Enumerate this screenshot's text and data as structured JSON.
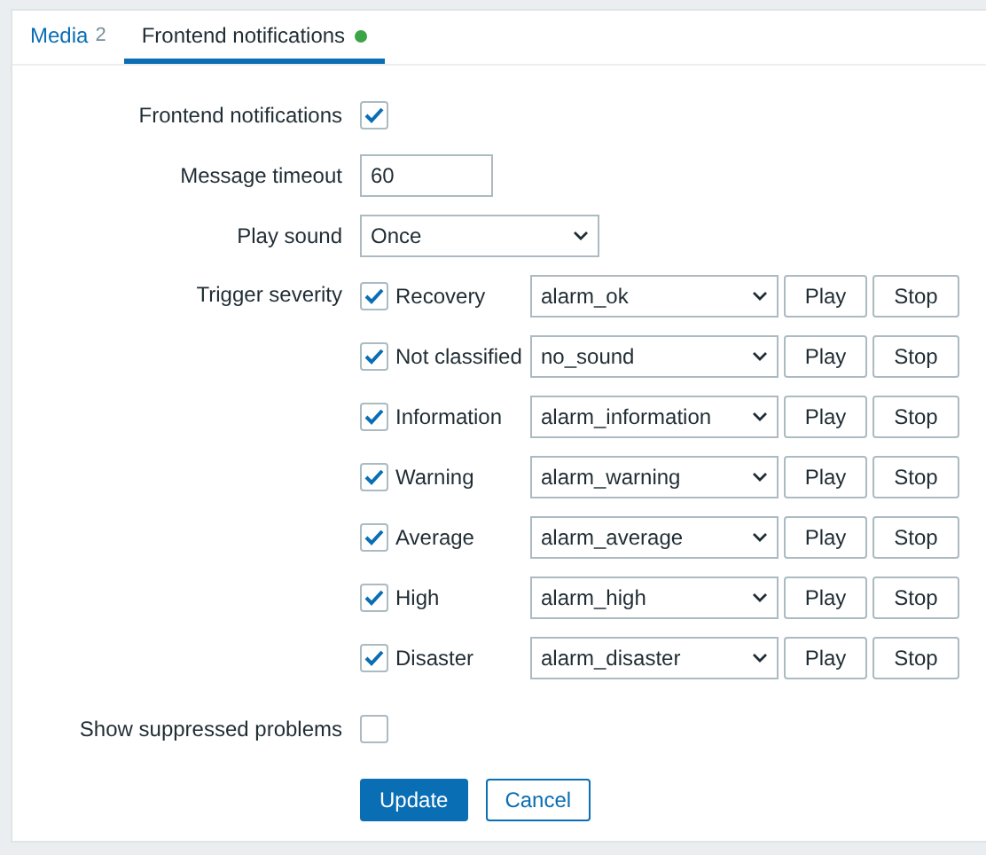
{
  "tabs": [
    {
      "label": "Media",
      "count": "2",
      "status_dot": false,
      "selected": false
    },
    {
      "label": "Frontend notifications",
      "status_dot": true,
      "selected": true
    }
  ],
  "form": {
    "frontend_notifications": {
      "label": "Frontend notifications",
      "checked": true
    },
    "message_timeout": {
      "label": "Message timeout",
      "value": "60"
    },
    "play_sound": {
      "label": "Play sound",
      "value": "Once"
    },
    "trigger_severity": {
      "label": "Trigger severity",
      "rows": [
        {
          "name": "Recovery",
          "checked": true,
          "sound": "alarm_ok",
          "play": "Play",
          "stop": "Stop"
        },
        {
          "name": "Not classified",
          "checked": true,
          "sound": "no_sound",
          "play": "Play",
          "stop": "Stop"
        },
        {
          "name": "Information",
          "checked": true,
          "sound": "alarm_information",
          "play": "Play",
          "stop": "Stop"
        },
        {
          "name": "Warning",
          "checked": true,
          "sound": "alarm_warning",
          "play": "Play",
          "stop": "Stop"
        },
        {
          "name": "Average",
          "checked": true,
          "sound": "alarm_average",
          "play": "Play",
          "stop": "Stop"
        },
        {
          "name": "High",
          "checked": true,
          "sound": "alarm_high",
          "play": "Play",
          "stop": "Stop"
        },
        {
          "name": "Disaster",
          "checked": true,
          "sound": "alarm_disaster",
          "play": "Play",
          "stop": "Stop"
        }
      ]
    },
    "show_suppressed": {
      "label": "Show suppressed problems",
      "checked": false
    }
  },
  "buttons": {
    "update": "Update",
    "cancel": "Cancel"
  }
}
